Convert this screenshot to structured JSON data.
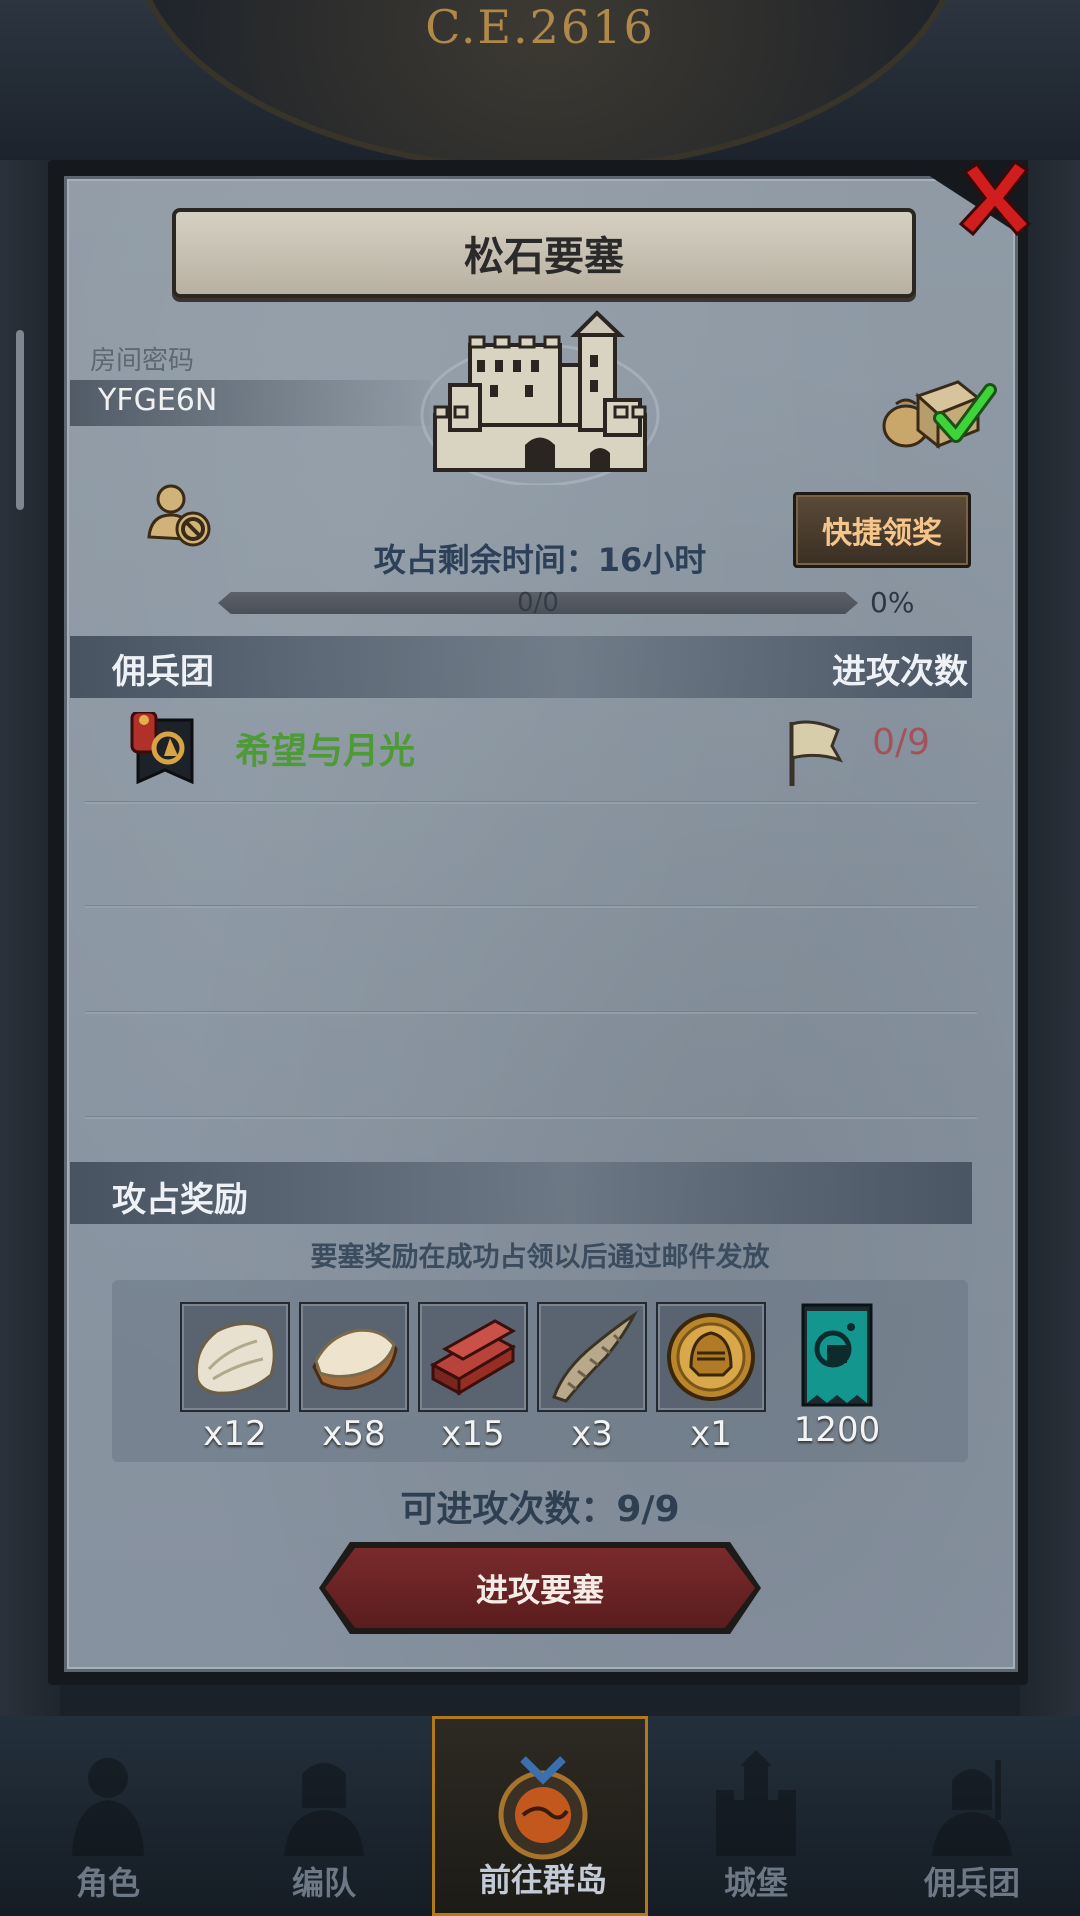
{
  "background": {
    "year_text": "C.E.2616"
  },
  "dialog": {
    "title": "松石要塞",
    "room": {
      "label": "房间密码",
      "code": "YFGE6N"
    },
    "quick_claim_label": "快捷领奖",
    "remaining_time_text": "攻占剩余时间：16小时",
    "progress": {
      "text": "0/0",
      "percent_text": "0%",
      "value": 0
    },
    "mercenary_header": {
      "left": "佣兵团",
      "right": "进攻次数"
    },
    "mercenaries": [
      {
        "name": "希望与月光",
        "attacks": "0/9"
      }
    ],
    "rewards_header": "攻占奖励",
    "reward_note": "要塞奖励在成功占领以后通过邮件发放",
    "rewards": [
      {
        "icon": "fur-pelt-icon",
        "qty": "x12"
      },
      {
        "icon": "leather-hide-icon",
        "qty": "x58"
      },
      {
        "icon": "wood-planks-icon",
        "qty": "x15"
      },
      {
        "icon": "horn-icon",
        "qty": "x3"
      },
      {
        "icon": "knight-helmet-coin-icon",
        "qty": "x1"
      },
      {
        "icon": "guild-banner-icon",
        "qty": "1200"
      }
    ],
    "attempts_text": "可进攻次数：9/9",
    "attack_button_label": "进攻要塞"
  },
  "bottom_nav": [
    {
      "label": "角色",
      "icon": "character-icon",
      "active": false
    },
    {
      "label": "编队",
      "icon": "formation-icon",
      "active": false
    },
    {
      "label": "前往群岛",
      "icon": "islands-icon",
      "active": true
    },
    {
      "label": "城堡",
      "icon": "castle-icon",
      "active": false
    },
    {
      "label": "佣兵团",
      "icon": "mercenary-icon",
      "active": false
    }
  ],
  "colors": {
    "accent_green": "#4d9a36",
    "attack_count_red": "#a4525a",
    "quick_claim_text": "#f5c58b",
    "attack_button": "#6b2425",
    "nav_active_border": "#b07a18"
  }
}
